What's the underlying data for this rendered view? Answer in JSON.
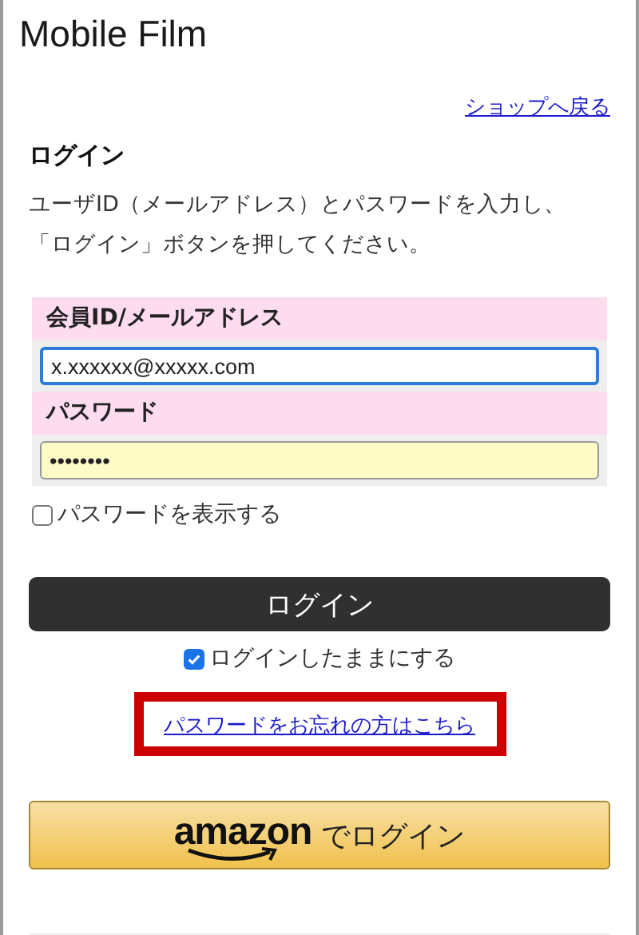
{
  "title": "Mobile Film",
  "back_link": "ショップへ戻る",
  "heading": "ログイン",
  "description": "ユーザID（メールアドレス）とパスワードを入力し、「ログイン」ボタンを押してください。",
  "fields": [
    {
      "label": "会員ID/メールアドレス",
      "value": "x.xxxxxx@xxxxx.com",
      "kind": "text",
      "focused": true
    },
    {
      "label": "パスワード",
      "value": "••••••••",
      "kind": "password",
      "focused": false
    }
  ],
  "show_password": {
    "label": "パスワードを表示する",
    "checked": false
  },
  "login_button": "ログイン",
  "keep_logged_in": {
    "label": "ログインしたままにする",
    "checked": true
  },
  "forgot_link": {
    "label": "パスワードをお忘れの方はこちら",
    "highlighted": true
  },
  "amazon_button": {
    "logo": "amazon",
    "label": "でログイン"
  }
}
